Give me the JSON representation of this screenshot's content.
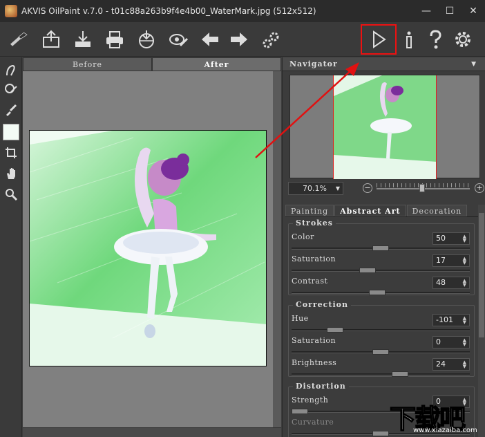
{
  "window": {
    "title": "AKVIS OilPaint v.7.0 - t01c88a263b9f4e4b00_WaterMark.jpg (512x512)",
    "minimize": "—",
    "maximize": "☐",
    "close": "✕"
  },
  "toolbar": {
    "buttons": [
      "logo-brush-icon",
      "open-icon",
      "save-icon",
      "print-icon",
      "share-icon",
      "batch-icon",
      "back-icon",
      "forward-icon",
      "preferences-gear-icon",
      "run-icon",
      "info-icon",
      "help-icon",
      "settings-gear-icon"
    ]
  },
  "left_tools": [
    "smudge-icon",
    "eraser-icon",
    "brush-icon",
    "color-swatch",
    "crop-icon",
    "hand-icon",
    "zoom-icon"
  ],
  "view": {
    "tabs": [
      "Before",
      "After"
    ],
    "active_tab": "After"
  },
  "navigator": {
    "title": "Navigator",
    "zoom": "70.1%"
  },
  "settings": {
    "tabs": [
      "Painting",
      "Abstract Art",
      "Decoration"
    ],
    "active_tab": "Abstract Art",
    "groups": [
      {
        "title": "Strokes",
        "params": [
          {
            "label": "Color",
            "value": "50",
            "level": 0.5
          },
          {
            "label": "Saturation",
            "value": "17",
            "level": 0.42
          },
          {
            "label": "Contrast",
            "value": "48",
            "level": 0.48
          }
        ]
      },
      {
        "title": "Correction",
        "params": [
          {
            "label": "Hue",
            "value": "-101",
            "level": 0.22
          },
          {
            "label": "Saturation",
            "value": "0",
            "level": 0.5
          },
          {
            "label": "Brightness",
            "value": "24",
            "level": 0.62
          }
        ]
      },
      {
        "title": "Distortion",
        "params": [
          {
            "label": "Strength",
            "value": "0",
            "level": 0.0
          },
          {
            "label": "Curvature",
            "value": "",
            "level": 0.5,
            "disabled": true
          }
        ]
      }
    ]
  },
  "watermark": {
    "text": "下载吧",
    "url": "www.xiazaiba.com"
  },
  "colors": {
    "highlight": "#e11111",
    "accent_green": "#3fc451"
  }
}
